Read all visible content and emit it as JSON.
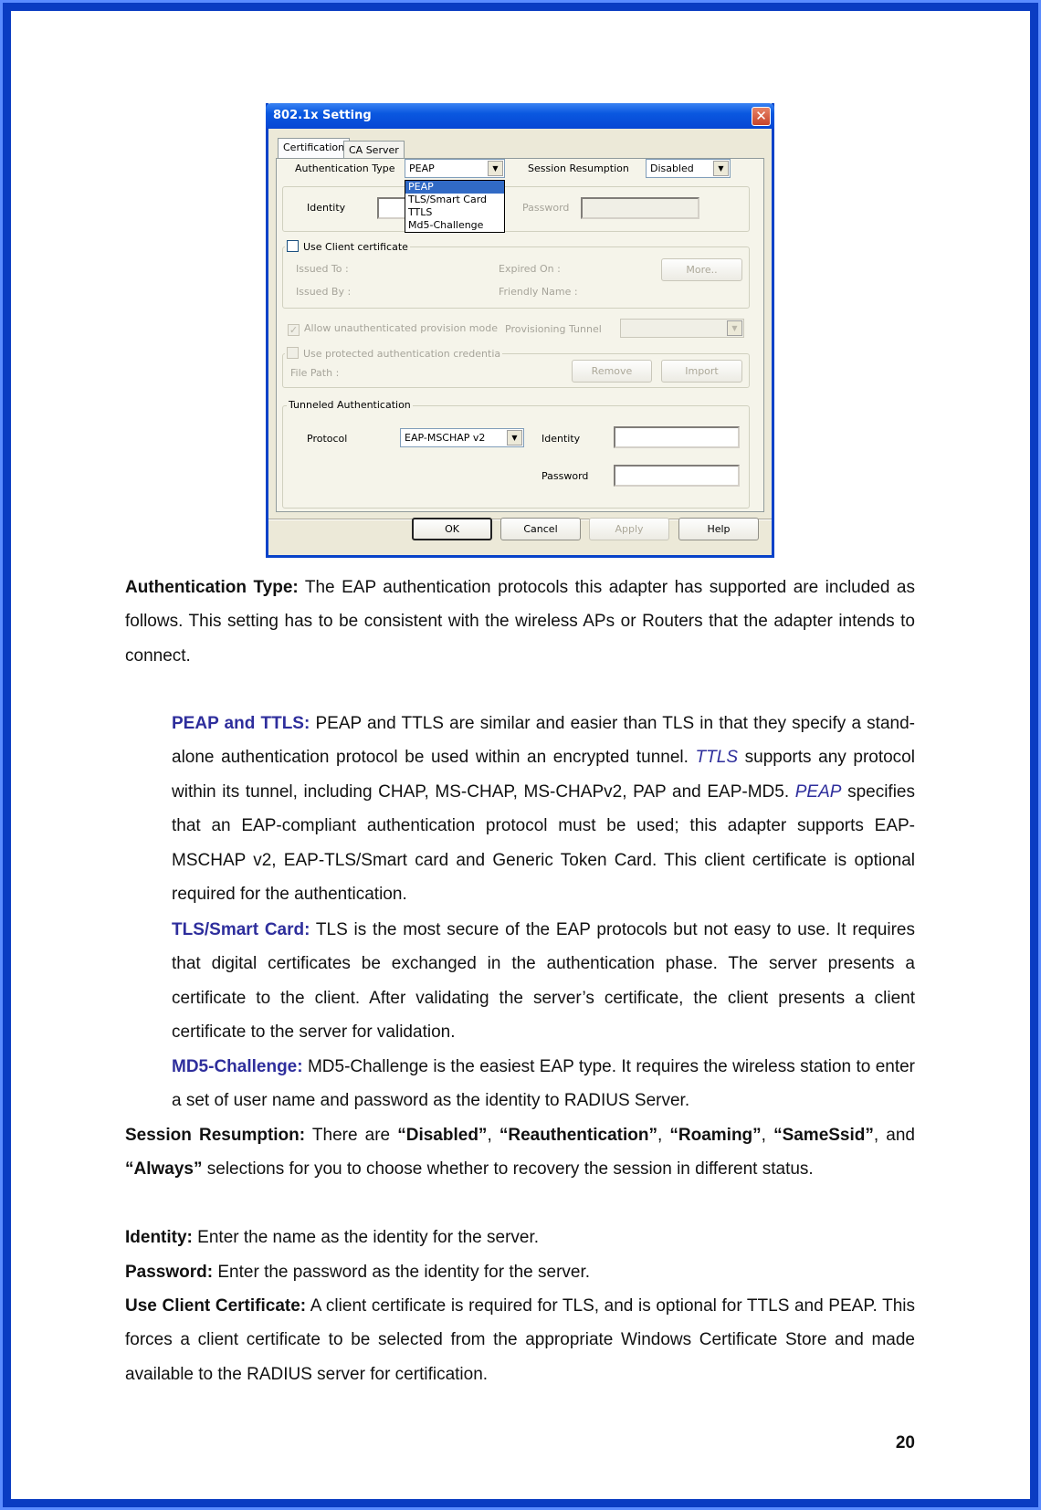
{
  "dialog": {
    "title": "802.1x Setting",
    "tabs": [
      {
        "label": "Certification",
        "active": true
      },
      {
        "label": "CA Server",
        "active": false
      }
    ],
    "authentication_type": {
      "label": "Authentication Type",
      "value": "PEAP",
      "options": [
        "PEAP",
        "TLS/Smart Card",
        "TTLS",
        "Md5-Challenge"
      ],
      "highlighted": "PEAP"
    },
    "session_resumption": {
      "label": "Session Resumption",
      "value": "Disabled"
    },
    "identity_label": "Identity",
    "identity_value": "",
    "password_label": "Password",
    "password_value": "",
    "use_client_certificate": {
      "label": "Use Client certificate",
      "checked": false
    },
    "issued_to_label": "Issued To :",
    "issued_by_label": "Issued By :",
    "expired_on_label": "Expired On :",
    "friendly_name_label": "Friendly Name :",
    "more_button": "More..",
    "allow_unauthenticated": {
      "label": "Allow unauthenticated provision mode",
      "checked": true
    },
    "provisioning_tunnel_label": "Provisioning Tunnel",
    "provisioning_tunnel_value": "",
    "use_protected_credentials": {
      "label": "Use protected authentication credentia",
      "checked": false
    },
    "file_path_label": "File Path :",
    "remove_button": "Remove",
    "import_button": "Import",
    "tunneled": {
      "group_title": "Tunneled Authentication",
      "protocol_label": "Protocol",
      "protocol_value": "EAP-MSCHAP v2",
      "identity_label": "Identity",
      "identity_value": "",
      "password_label": "Password",
      "password_value": ""
    },
    "buttons": {
      "ok": "OK",
      "cancel": "Cancel",
      "apply": "Apply",
      "help": "Help"
    },
    "close_icon": "close-icon"
  },
  "content": {
    "auth_type": {
      "term": "Authentication Type:",
      "text": " The EAP authentication protocols this adapter has supported are included as follows. This setting has to be consistent with the wireless APs or Routers that the adapter intends to connect."
    },
    "peap_ttls": {
      "term": "PEAP and TTLS:",
      "text1": " PEAP and TTLS are similar and easier than TLS in that they specify a stand-alone authentication protocol be used within an encrypted tunnel. ",
      "ttls": "TTLS",
      "text2": " supports any protocol within its tunnel, including CHAP, MS-CHAP, MS-CHAPv2, PAP and EAP-MD5. ",
      "peap": "PEAP",
      "text3": " specifies that an EAP-compliant authentication protocol must be used; this adapter supports EAP-MSCHAP v2, EAP-TLS/Smart card and Generic Token Card. This client certificate is optional required for the authentication."
    },
    "tls": {
      "term": "TLS/Smart Card:",
      "text": " TLS is the most secure of the EAP protocols but not easy to use. It requires that digital certificates be exchanged in the authentication phase. The server presents a certificate to the client. After validating the server’s certificate, the client presents a client certificate to the server for validation."
    },
    "md5": {
      "term": "MD5-Challenge:",
      "text": " MD5-Challenge is the easiest EAP type. It requires the wireless station to enter a set of user name and password as the identity to RADIUS Server."
    },
    "session": {
      "term": "Session Resumption:",
      "t1": " There are ",
      "o1": "“Disabled”",
      "t2": ", ",
      "o2": "“Reauthentication”",
      "t3": ", ",
      "o3": "“Roaming”",
      "t4": ", ",
      "o4": "“SameSsid”",
      "t5": ", and ",
      "o5": "“Always”",
      "t6": " selections for you to choose whether to recovery the session in different status."
    },
    "identity": {
      "term": "Identity:",
      "text": " Enter the name as the identity for the server."
    },
    "password": {
      "term": "Password:",
      "text": " Enter the password as the identity for the server."
    },
    "use_client_cert": {
      "term": "Use Client Certificate:",
      "text": " A client certificate is required for TLS, and is optional for TTLS and PEAP. This forces a client certificate to be selected from the appropriate Windows Certificate Store and made available to the RADIUS server for certification."
    }
  },
  "page_number": "20",
  "colors": {
    "frame_outer": "#5b8cff",
    "frame_inner": "#0a3cc2",
    "term_blue": "#2e2e9c",
    "selection": "#316ac5"
  }
}
